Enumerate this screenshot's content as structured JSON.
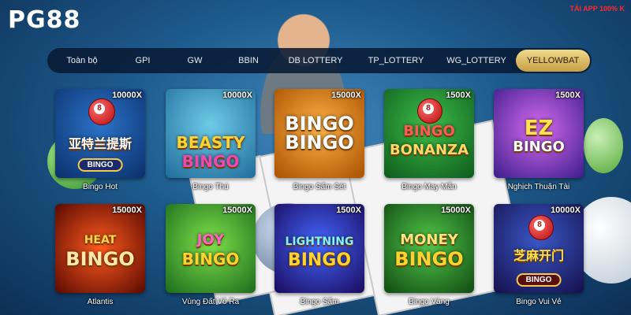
{
  "brand": {
    "logo": "PG88"
  },
  "header": {
    "app_link": "TẢI APP 100% K"
  },
  "tabs": [
    {
      "label": "Toàn bộ"
    },
    {
      "label": "GPI"
    },
    {
      "label": "GW"
    },
    {
      "label": "BBIN"
    },
    {
      "label": "DB LOTTERY"
    },
    {
      "label": "TP_LOTTERY"
    },
    {
      "label": "WG_LOTTERY"
    },
    {
      "label": "YELLOWBAT",
      "active": true
    }
  ],
  "games": [
    {
      "multiplier": "10000X",
      "art_title_1": "亚特兰提斯",
      "art_title_2": "BINGO",
      "label": "Bingo Hot"
    },
    {
      "multiplier": "10000X",
      "art_title_1": "BEASTY",
      "art_title_2": "BINGO",
      "label": "Bingo Thú"
    },
    {
      "multiplier": "15000X",
      "art_title_1": "BINGO",
      "art_title_2": "BINGO",
      "label": "Bingo Sấm Sét"
    },
    {
      "multiplier": "1500X",
      "art_title_1": "BINGO",
      "art_title_2": "BONANZA",
      "label": "Bingo May Mắn"
    },
    {
      "multiplier": "1500X",
      "art_title_1": "EZ",
      "art_title_2": "BINGO",
      "label": "Nghịch Thuận Tài"
    },
    {
      "multiplier": "15000X",
      "art_title_1": "HEAT",
      "art_title_2": "BINGO",
      "label": "Atlantis"
    },
    {
      "multiplier": "15000X",
      "art_title_1": "JOY",
      "art_title_2": "BINGO",
      "label": "Vùng Đất Vô Ra"
    },
    {
      "multiplier": "1500X",
      "art_title_1": "LIGHTNING",
      "art_title_2": "BINGO",
      "label": "Bingo Sấm"
    },
    {
      "multiplier": "15000X",
      "art_title_1": "MONEY",
      "art_title_2": "BINGO",
      "label": "Bingo Vàng"
    },
    {
      "multiplier": "10000X",
      "art_title_1": "芝麻开门",
      "art_title_2": "BINGO",
      "label": "Bingo Vui Vẻ"
    }
  ]
}
